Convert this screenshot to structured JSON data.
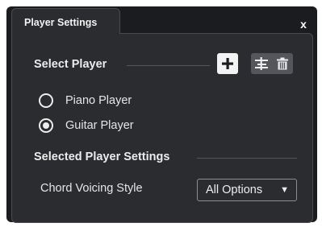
{
  "window": {
    "tab_title": "Player Settings",
    "close_glyph": "x"
  },
  "select_player": {
    "heading": "Select Player",
    "toolbar": {
      "add_icon": "plus-icon",
      "remove_icon": "remove-player-icon",
      "delete_icon": "trash-icon"
    },
    "options": [
      {
        "label": "Piano Player",
        "selected": false
      },
      {
        "label": "Guitar Player",
        "selected": true
      }
    ]
  },
  "player_settings": {
    "heading": "Selected Player Settings",
    "chord_voicing_label": "Chord Voicing Style",
    "chord_voicing_value": "All Options",
    "dropdown_arrow": "▼"
  },
  "colors": {
    "background": "#2b2c30",
    "window_frame": "#1b1c1f",
    "button_gray": "#55565b",
    "button_light": "#f3f3f3",
    "text": "#e6e6e6"
  }
}
